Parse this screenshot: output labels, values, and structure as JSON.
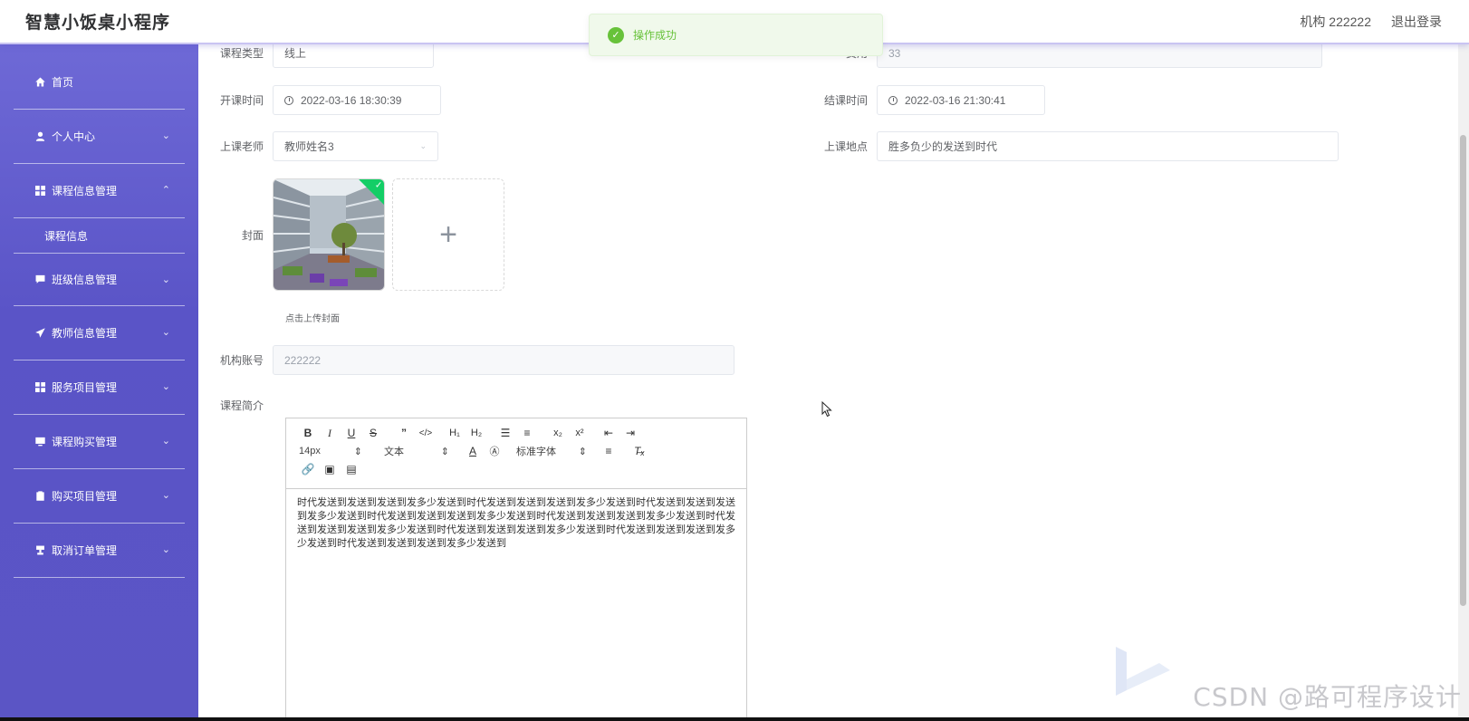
{
  "app": {
    "title": "智慧小饭桌小程序"
  },
  "header": {
    "user_label": "机构 222222",
    "logout_label": "退出登录"
  },
  "toast": {
    "message": "操作成功"
  },
  "sidebar": {
    "items": [
      {
        "label": "首页",
        "icon": "home-icon"
      },
      {
        "label": "个人中心",
        "icon": "user-icon"
      },
      {
        "label": "课程信息管理",
        "icon": "grid-icon"
      },
      {
        "label": "课程信息"
      },
      {
        "label": "班级信息管理",
        "icon": "chat-icon"
      },
      {
        "label": "教师信息管理",
        "icon": "send-icon"
      },
      {
        "label": "服务项目管理",
        "icon": "grid-icon"
      },
      {
        "label": "课程购买管理",
        "icon": "monitor-icon"
      },
      {
        "label": "购买项目管理",
        "icon": "clipboard-icon"
      },
      {
        "label": "取消订单管理",
        "icon": "stamp-icon"
      }
    ]
  },
  "form": {
    "course_type": {
      "label": "课程类型",
      "value": "线上"
    },
    "fee": {
      "label": "费用",
      "value": "33"
    },
    "start_time": {
      "label": "开课时间",
      "value": "2022-03-16 18:30:39"
    },
    "end_time": {
      "label": "结课时间",
      "value": "2022-03-16 21:30:41"
    },
    "teacher": {
      "label": "上课老师",
      "value": "教师姓名3"
    },
    "location": {
      "label": "上课地点",
      "value": "胜多负少的发送到时代"
    },
    "cover": {
      "label": "封面",
      "hint": "点击上传封面"
    },
    "account": {
      "label": "机构账号",
      "value": "222222"
    },
    "intro": {
      "label": "课程简介",
      "font_size": "14px",
      "text_style": "文本",
      "font_family": "标准字体",
      "content": "时代发送到发送到发送到发多少发送到时代发送到发送到发送到发多少发送到时代发送到发送到发送到发多少发送到时代发送到发送到发送到发多少发送到时代发送到发送到发送到发多少发送到时代发送到发送到发送到发多少发送到时代发送到发送到发送到发多少发送到时代发送到发送到发送到发多少发送到时代发送到发送到发送到发多少发送到"
    }
  },
  "watermark": "CSDN @路可程序设计"
}
